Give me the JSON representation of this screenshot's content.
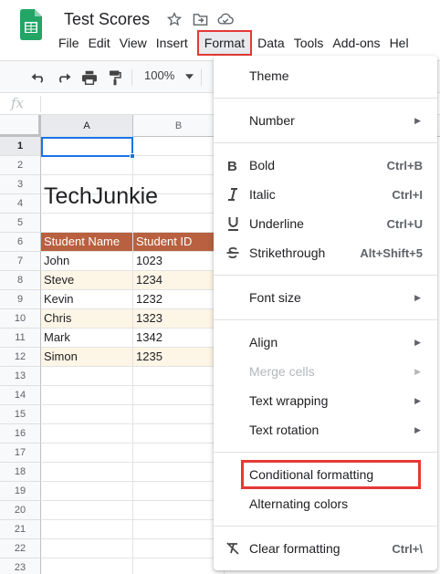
{
  "app": {
    "doc_title": "Test Scores",
    "menus": [
      "File",
      "Edit",
      "View",
      "Insert",
      "Format",
      "Data",
      "Tools",
      "Add-ons",
      "Hel"
    ],
    "active_menu": "Format"
  },
  "toolbar": {
    "zoom": "100%"
  },
  "formula_bar": {
    "fx_label": "fx"
  },
  "grid": {
    "columns": [
      "A",
      "B"
    ],
    "rows": [
      "1",
      "2",
      "3",
      "4",
      "5",
      "6",
      "7",
      "8",
      "9",
      "10",
      "11",
      "12",
      "13",
      "14",
      "15",
      "16",
      "17",
      "18",
      "19",
      "20",
      "21",
      "22",
      "23"
    ],
    "title_text": "TechJunkie",
    "table_headers": [
      "Student Name",
      "Student ID"
    ],
    "table_rows": [
      [
        "John",
        "1023"
      ],
      [
        "Steve",
        "1234"
      ],
      [
        "Kevin",
        "1232"
      ],
      [
        "Chris",
        "1323"
      ],
      [
        "Mark",
        "1342"
      ],
      [
        "Simon",
        "1235"
      ]
    ]
  },
  "format_menu": {
    "theme": "Theme",
    "number": "Number",
    "bold": "Bold",
    "bold_shortcut": "Ctrl+B",
    "italic": "Italic",
    "italic_shortcut": "Ctrl+I",
    "underline": "Underline",
    "underline_shortcut": "Ctrl+U",
    "strikethrough": "Strikethrough",
    "strikethrough_shortcut": "Alt+Shift+5",
    "font_size": "Font size",
    "align": "Align",
    "merge_cells": "Merge cells",
    "text_wrapping": "Text wrapping",
    "text_rotation": "Text rotation",
    "conditional_formatting": "Conditional formatting",
    "alternating_colors": "Alternating colors",
    "clear_formatting": "Clear formatting",
    "clear_formatting_shortcut": "Ctrl+\\"
  },
  "colors": {
    "header_fill": "#b8603f",
    "band_fill": "#fdf5e6",
    "highlight": "#e53935",
    "selection": "#1a73e8"
  }
}
